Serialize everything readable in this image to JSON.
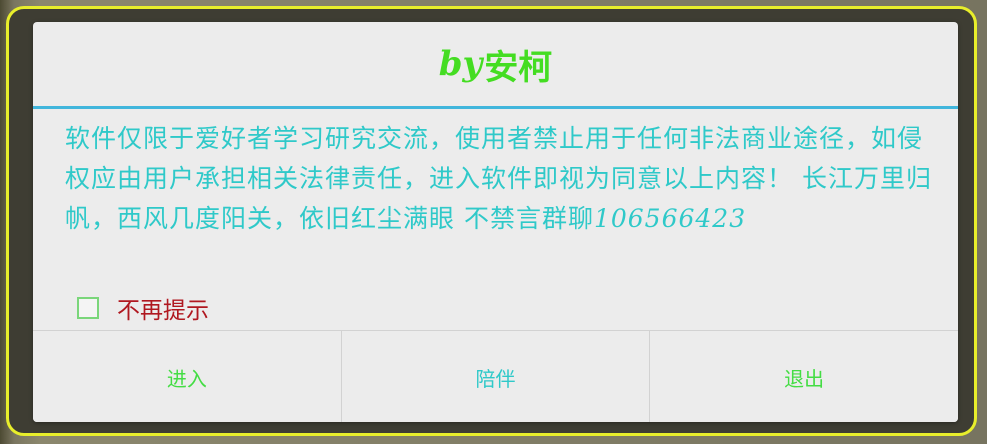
{
  "dialog": {
    "title_prefix": "by",
    "title_name": "安柯",
    "message_text": "软件仅限于爱好者学习研究交流，使用者禁止用于任何非法商业途径，如侵权应由用户承担相关法律责任，进入软件即视为同意以上内容！ 长江万里归帆，西风几度阳关，依旧红尘满眼 不禁言群聊",
    "message_number": "106566423",
    "checkbox_label": "不再提示",
    "checkbox_checked": false,
    "buttons": {
      "enter": "进入",
      "accompany": "陪伴",
      "exit": "退出"
    }
  },
  "colors": {
    "title": "#44dd22",
    "divider": "#41b6dc",
    "message": "#2fc9c9",
    "checkbox_label": "#b01820",
    "frame_border": "#e8ee2b"
  }
}
